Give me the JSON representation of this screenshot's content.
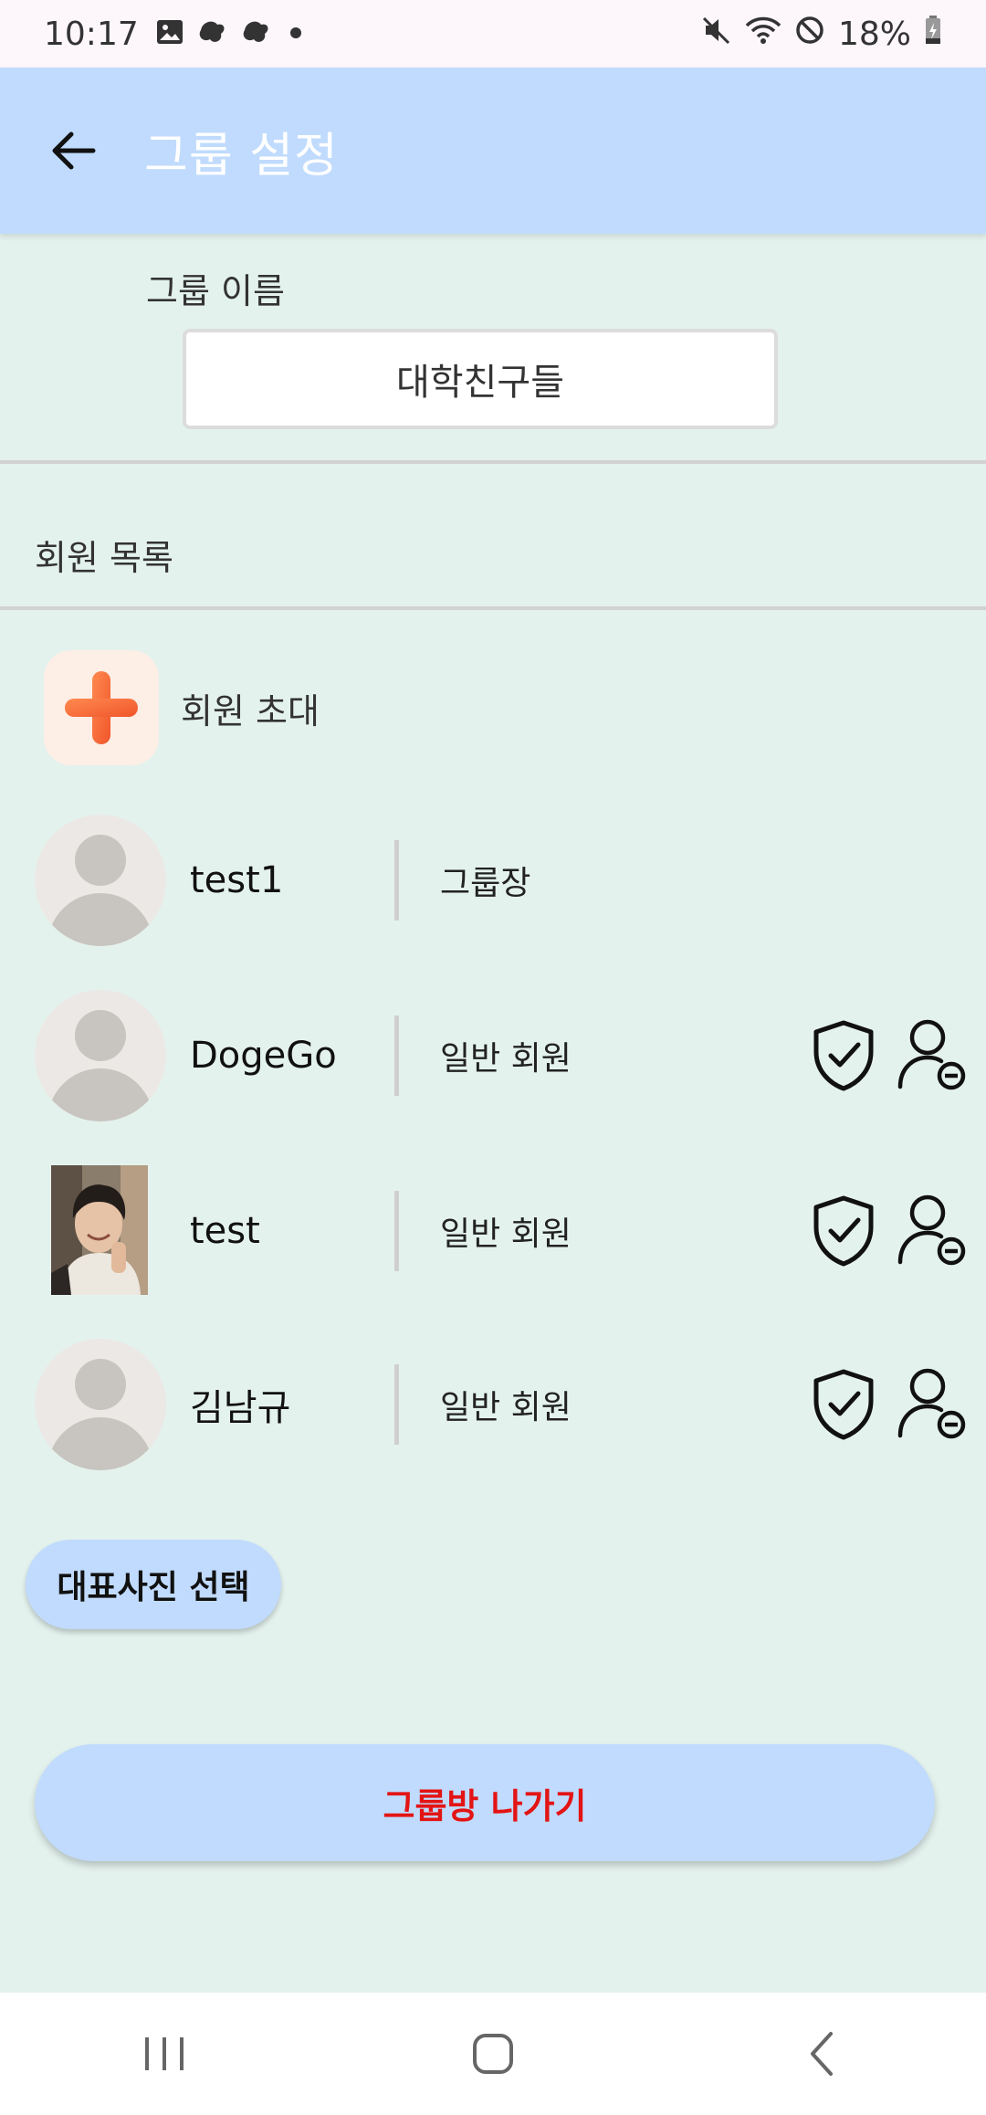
{
  "status_bar": {
    "time": "10:17",
    "battery": "18%",
    "icons_left": [
      "image-icon",
      "leaf-icon",
      "leaf-icon",
      "dot-icon"
    ],
    "icons_right": [
      "mute-icon",
      "wifi-icon",
      "blocked-icon",
      "battery-icon"
    ]
  },
  "app_bar": {
    "title": "그룹 설정",
    "back_icon": "arrow-left-icon",
    "background": "#c0dbfd"
  },
  "group_name": {
    "label": "그룹 이름",
    "value": "대학친구들"
  },
  "members": {
    "label": "회원 목록",
    "invite_label": "회원 초대",
    "items": [
      {
        "name": "test1",
        "role": "그룹장",
        "avatar": "default",
        "actions": []
      },
      {
        "name": "DogeGo",
        "role": "일반 회원",
        "avatar": "default",
        "actions": [
          "shield-check-icon",
          "user-remove-icon"
        ]
      },
      {
        "name": "test",
        "role": "일반 회원",
        "avatar": "photo",
        "actions": [
          "shield-check-icon",
          "user-remove-icon"
        ]
      },
      {
        "name": "김남규",
        "role": "일반 회원",
        "avatar": "default",
        "actions": [
          "shield-check-icon",
          "user-remove-icon"
        ]
      }
    ]
  },
  "buttons": {
    "rep_photo": "대표사진 선택",
    "leave": "그룹방 나가기"
  },
  "colors": {
    "background": "#e4f2ee",
    "accent": "#c0dbfd",
    "danger": "#e31414",
    "plus": "#f56a35"
  }
}
